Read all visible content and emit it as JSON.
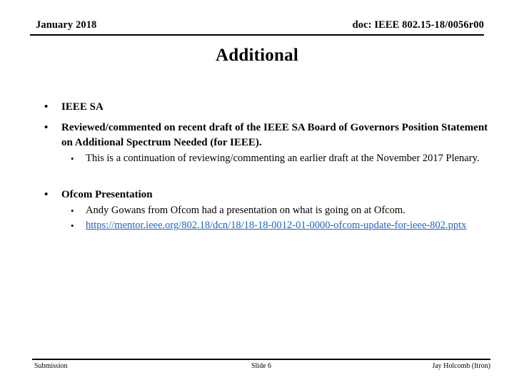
{
  "header": {
    "left": "January 2018",
    "right": "doc: IEEE 802.15-18/0056r00"
  },
  "title": "Additional",
  "body": {
    "bullet_glyph": "•",
    "items": [
      {
        "level": 1,
        "text": "IEEE SA"
      },
      {
        "level": 1,
        "text": "Reviewed/commented on recent draft of the IEEE SA Board of Governors Position Statement on Additional Spectrum Needed (for IEEE)."
      },
      {
        "level": 2,
        "text": "This is a continuation of reviewing/commenting an earlier draft at the November 2017 Plenary."
      },
      {
        "level": 1,
        "text": "Ofcom Presentation"
      },
      {
        "level": 2,
        "text": "Andy Gowans from Ofcom had a presentation on what is going on at Ofcom."
      },
      {
        "level": 2,
        "link": true,
        "text": "https://mentor.ieee.org/802.18/dcn/18/18-18-0012-01-0000-ofcom-update-for-ieee-802.pptx"
      }
    ]
  },
  "footer": {
    "left": "Submission",
    "center": "Slide 6",
    "right": "Jay Holcomb (Itron)"
  },
  "colors": {
    "link": "#1F61C7",
    "text": "#000000",
    "background": "#ffffff"
  }
}
